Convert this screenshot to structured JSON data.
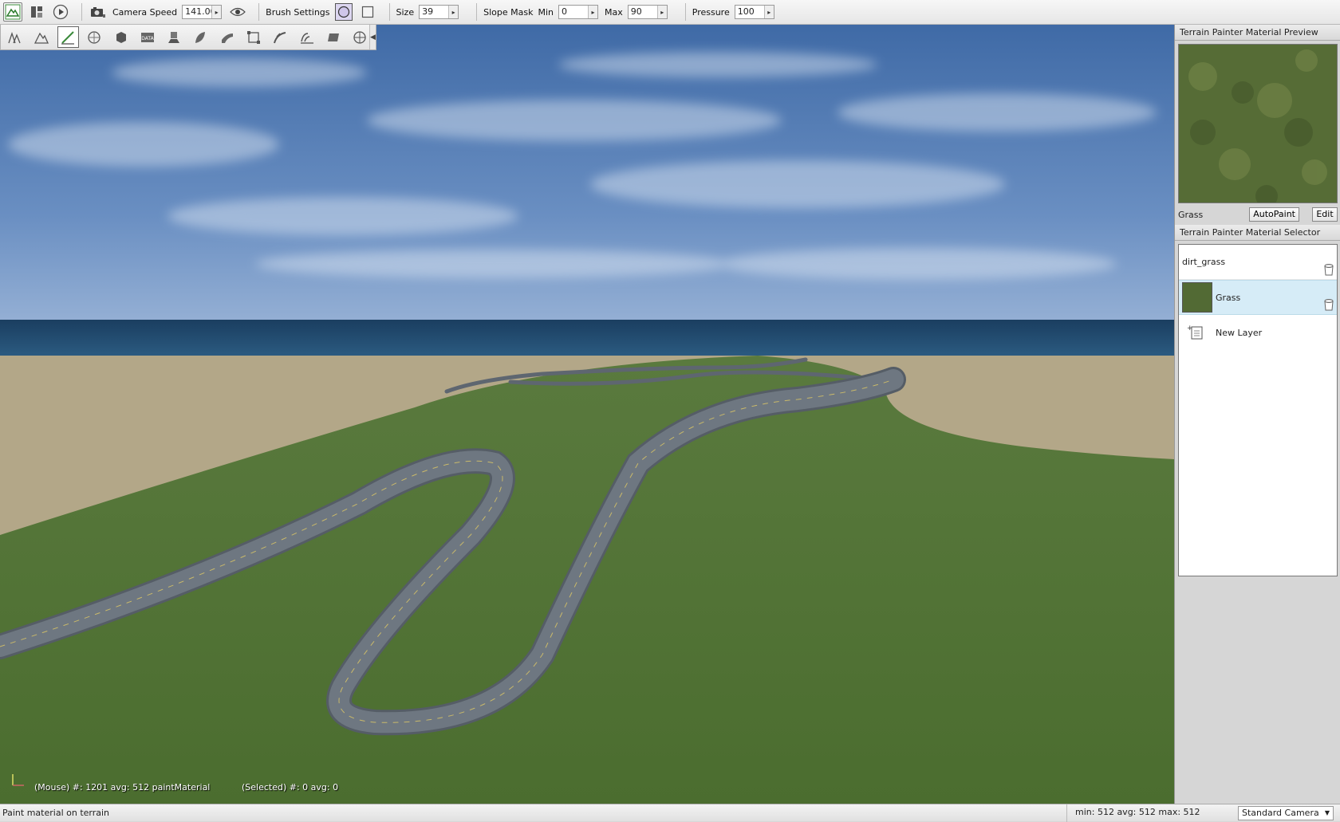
{
  "toolbar": {
    "camera_speed_label": "Camera Speed",
    "camera_speed_value": "141.00",
    "brush_settings_label": "Brush Settings",
    "size_label": "Size",
    "size_value": "39",
    "slope_mask_label": "Slope Mask",
    "min_label": "Min",
    "min_value": "0",
    "max_label": "Max",
    "max_value": "90",
    "pressure_label": "Pressure",
    "pressure_value": "100",
    "buttons": [
      "world-editor-icon",
      "gui-editor-icon",
      "play-icon",
      "camera-icon",
      "visibility-icon"
    ],
    "brush_shapes": [
      "circle-brush-icon",
      "square-brush-icon"
    ]
  },
  "palette": {
    "tools": [
      "object-select-icon",
      "terrain-edit-icon",
      "terrain-paint-icon",
      "material-editor-icon",
      "sketch-icon",
      "datablock-icon",
      "decal-icon",
      "forest-icon",
      "mesh-road-icon",
      "convex-editor-icon",
      "river-icon",
      "road-icon",
      "navmesh-icon",
      "particle-icon"
    ],
    "active_tool_index": 2
  },
  "hud": {
    "mouse_info": "(Mouse) #: 1201  avg: 512 paintMaterial",
    "selected_info": "(Selected) #: 0  avg: 0"
  },
  "preview_panel": {
    "title": "Terrain Painter Material Preview",
    "material_name": "Grass",
    "autopaint_label": "AutoPaint",
    "edit_label": "Edit"
  },
  "selector_panel": {
    "title": "Terrain Painter Material Selector",
    "materials": [
      {
        "name": "dirt_grass",
        "selected": false
      },
      {
        "name": "Grass",
        "selected": true
      }
    ],
    "new_layer_label": "New Layer"
  },
  "statusbar": {
    "message": "Paint material on terrain",
    "stats": "min: 512  avg: 512  max: 512",
    "camera_mode": "Standard Camera"
  },
  "colors": {
    "grass": "#4f6e35",
    "sand": "#b3a788",
    "sea": "#214d73",
    "sky": "#5d82b5",
    "road": "#67707a",
    "selection": "#d6ecf7"
  }
}
